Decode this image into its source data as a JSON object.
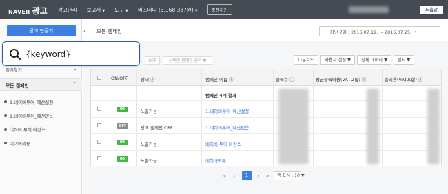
{
  "nav": {
    "brand_naver": "NAVER",
    "brand_ad": "광고",
    "items": [
      {
        "label": "광고관리",
        "caret": ""
      },
      {
        "label": "보고서",
        "caret": "▼"
      },
      {
        "label": "도구",
        "caret": "▼"
      },
      {
        "label": "비즈머니 (3,168,387원)",
        "caret": "▼"
      }
    ],
    "charge": "충전하기",
    "help": "도움말"
  },
  "sidebar": {
    "create": "광고 만들기",
    "favorites": "즐겨찾기",
    "all": "모든 캠페인",
    "campaigns": [
      "1.네이버투어_예산설정",
      "1.네이버투어_예산없음",
      "네이버 투어 바캉스",
      "네이버외류"
    ]
  },
  "search": {
    "value": "{keyword}"
  },
  "header": {
    "collapse": "‹",
    "title": "모든 캠페인",
    "date_prev": "‹",
    "date_range": "지난 7일 : 2016.07.19. ~ 2016.07.25.",
    "date_next": "›"
  },
  "toolbar": {
    "off": "OFF",
    "settings": "선택한 캠페인 관리 ▼",
    "download": "다운로드",
    "user_settings": "사용자 설정 ▼",
    "detail_data": "상세 데이터 ▼",
    "filter": "필터 ▼"
  },
  "table": {
    "headers": [
      "ON/OFF",
      "상태 ⓘ",
      "캠페인 이름 ⓘ",
      "클릭수 ⓘ",
      "평균클릭비용(VAT포함) ⓘ",
      "총비용(VAT포함) ⓘ"
    ],
    "summary": "캠페인 4개 결과",
    "rows": [
      {
        "toggle": "ON",
        "status": "노출가능",
        "name": "1.네이버투어_예산설정"
      },
      {
        "toggle": "OFF",
        "status": "광고 캠페인 OFF",
        "name": "1.네이버투어_예산없음"
      },
      {
        "toggle": "ON",
        "status": "노출가능",
        "name": "네이버 투어 바캉스"
      },
      {
        "toggle": "ON",
        "status": "노출가능",
        "name": "네이버외류"
      }
    ]
  },
  "pager": {
    "first": "«",
    "prev": "‹",
    "page": "1",
    "next": "›",
    "last": "»",
    "per_page": "행 표시 : 10 ▼"
  },
  "colors": {
    "nav_bg": "#454b52",
    "primary": "#3d7fe3",
    "toggle_on": "#42b642",
    "link": "#2d6fd1"
  }
}
